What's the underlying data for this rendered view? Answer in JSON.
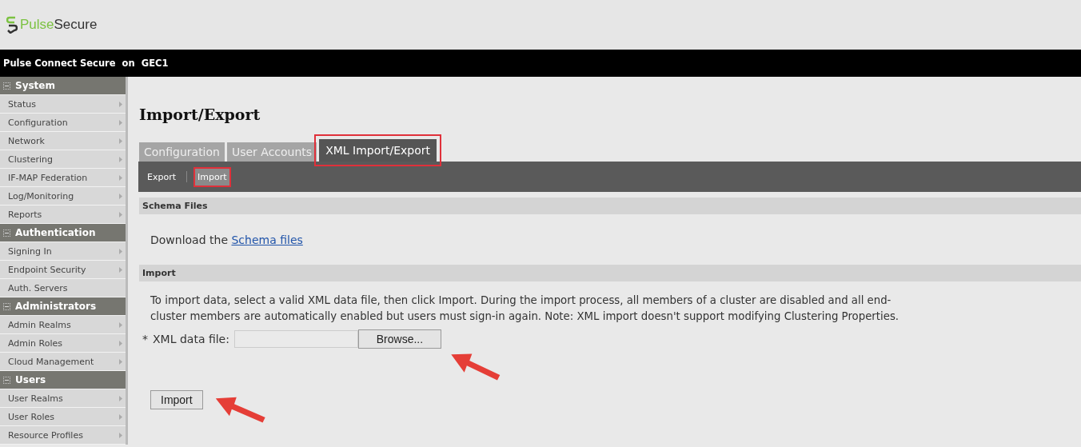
{
  "header": {
    "logo_text_a": "Pulse",
    "logo_text_b": "Secure"
  },
  "top_bar": {
    "product": "Pulse Connect Secure",
    "separator": "on",
    "host": "GEC1"
  },
  "sidebar": {
    "sections": [
      {
        "title": "System",
        "expanded": true,
        "items": [
          {
            "label": "Status",
            "has_submenu": true
          },
          {
            "label": "Configuration",
            "has_submenu": true
          },
          {
            "label": "Network",
            "has_submenu": true
          },
          {
            "label": "Clustering",
            "has_submenu": true
          },
          {
            "label": "IF-MAP Federation",
            "has_submenu": true
          },
          {
            "label": "Log/Monitoring",
            "has_submenu": true
          },
          {
            "label": "Reports",
            "has_submenu": true
          }
        ]
      },
      {
        "title": "Authentication",
        "expanded": true,
        "items": [
          {
            "label": "Signing In",
            "has_submenu": true
          },
          {
            "label": "Endpoint Security",
            "has_submenu": true
          },
          {
            "label": "Auth. Servers",
            "has_submenu": false
          }
        ]
      },
      {
        "title": "Administrators",
        "expanded": true,
        "items": [
          {
            "label": "Admin Realms",
            "has_submenu": true
          },
          {
            "label": "Admin Roles",
            "has_submenu": true
          },
          {
            "label": "Cloud Management",
            "has_submenu": true
          }
        ]
      },
      {
        "title": "Users",
        "expanded": true,
        "items": [
          {
            "label": "User Realms",
            "has_submenu": true
          },
          {
            "label": "User Roles",
            "has_submenu": true
          },
          {
            "label": "Resource Profiles",
            "has_submenu": true
          }
        ]
      }
    ]
  },
  "page": {
    "title": "Import/Export",
    "tabs": [
      {
        "label": "Configuration",
        "selected": false,
        "highlighted": false
      },
      {
        "label": "User Accounts",
        "selected": false,
        "highlighted": false
      },
      {
        "label": "XML Import/Export",
        "selected": true,
        "highlighted": true
      }
    ],
    "subtabs": [
      {
        "label": "Export",
        "selected": false,
        "highlighted": false
      },
      {
        "label": "Import",
        "selected": true,
        "highlighted": true
      }
    ],
    "schema_section": {
      "heading": "Schema Files",
      "text": "Download the",
      "link": "Schema files"
    },
    "import_section": {
      "heading": "Import",
      "description": [
        "To import data, select a valid XML data file, then click Import. During the import process, all members of a cluster are disabled and all end-",
        "cluster members are automatically enabled but users must sign-in again. Note: XML import doesn't support modifying Clustering Properties."
      ],
      "required_mark": "*",
      "field_label": "XML data file:",
      "browse_button": "Browse...",
      "import_button": "Import"
    }
  }
}
